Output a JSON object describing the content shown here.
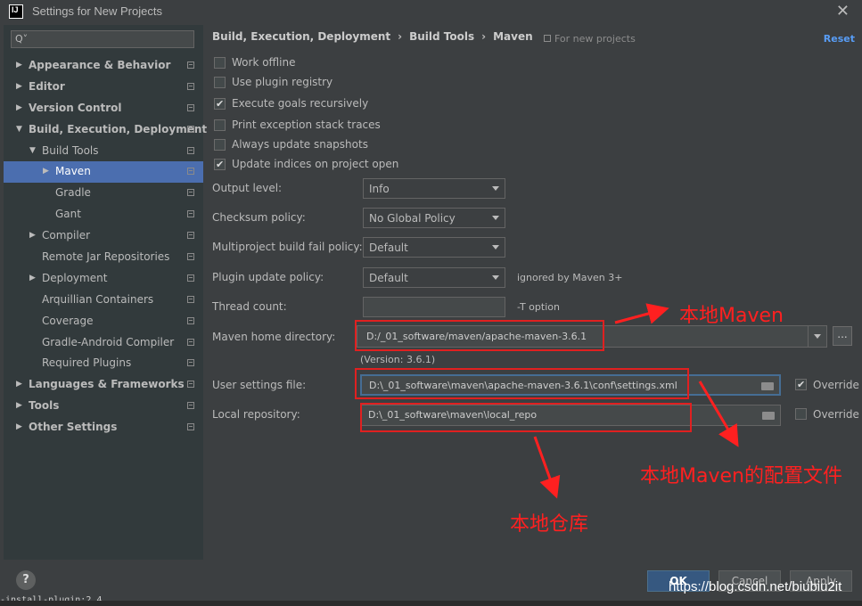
{
  "window": {
    "app_icon_text": "IJ",
    "title": "Settings for New Projects"
  },
  "sidebar": {
    "search_placeholder": "",
    "items": [
      {
        "label": "Appearance & Behavior",
        "level": 0,
        "arrow": "▶",
        "bold": true
      },
      {
        "label": "Editor",
        "level": 0,
        "arrow": "▶",
        "bold": true
      },
      {
        "label": "Version Control",
        "level": 0,
        "arrow": "▶",
        "bold": true
      },
      {
        "label": "Build, Execution, Deployment",
        "level": 0,
        "arrow": "▼",
        "bold": true
      },
      {
        "label": "Build Tools",
        "level": 1,
        "arrow": "▼",
        "bold": false
      },
      {
        "label": "Maven",
        "level": 2,
        "arrow": "▶",
        "bold": false,
        "selected": true
      },
      {
        "label": "Gradle",
        "level": 2,
        "arrow": "",
        "bold": false
      },
      {
        "label": "Gant",
        "level": 2,
        "arrow": "",
        "bold": false
      },
      {
        "label": "Compiler",
        "level": 1,
        "arrow": "▶",
        "bold": false
      },
      {
        "label": "Remote Jar Repositories",
        "level": 1,
        "arrow": "",
        "bold": false
      },
      {
        "label": "Deployment",
        "level": 1,
        "arrow": "▶",
        "bold": false
      },
      {
        "label": "Arquillian Containers",
        "level": 1,
        "arrow": "",
        "bold": false
      },
      {
        "label": "Coverage",
        "level": 1,
        "arrow": "",
        "bold": false
      },
      {
        "label": "Gradle-Android Compiler",
        "level": 1,
        "arrow": "",
        "bold": false
      },
      {
        "label": "Required Plugins",
        "level": 1,
        "arrow": "",
        "bold": false
      },
      {
        "label": "Languages & Frameworks",
        "level": 0,
        "arrow": "▶",
        "bold": true
      },
      {
        "label": "Tools",
        "level": 0,
        "arrow": "▶",
        "bold": true
      },
      {
        "label": "Other Settings",
        "level": 0,
        "arrow": "▶",
        "bold": true
      }
    ],
    "help_label": "?",
    "footer_text": "-install-plugin:2.4"
  },
  "breadcrumb": {
    "part1": "Build, Execution, Deployment",
    "part2": "Build Tools",
    "part3": "Maven",
    "separator": "›"
  },
  "header": {
    "for_new_projects": "For new projects",
    "reset_label": "Reset"
  },
  "options": {
    "work_offline": {
      "label": "Work offline",
      "checked": false
    },
    "use_plugin_registry": {
      "label": "Use plugin registry",
      "checked": false
    },
    "execute_goals_recursively": {
      "label": "Execute goals recursively",
      "checked": true
    },
    "print_exception_stack_traces": {
      "label": "Print exception stack traces",
      "checked": false
    },
    "always_update_snapshots": {
      "label": "Always update snapshots",
      "checked": false
    },
    "update_indices": {
      "label": "Update indices on project open",
      "checked": true
    }
  },
  "form": {
    "output_level": {
      "label": "Output level:",
      "value": "Info"
    },
    "checksum_policy": {
      "label": "Checksum policy:",
      "value": "No Global Policy"
    },
    "multiproject_fail_policy": {
      "label": "Multiproject build fail policy:",
      "value": "Default"
    },
    "plugin_update_policy": {
      "label": "Plugin update policy:",
      "value": "Default",
      "hint": "ignored by Maven 3+"
    },
    "thread_count": {
      "label": "Thread count:",
      "value": "",
      "hint": "-T option"
    },
    "maven_home": {
      "label": "Maven home directory:",
      "value": "D:/_01_software/maven/apache-maven-3.6.1",
      "version": "(Version: 3.6.1)",
      "browse_label": "..."
    },
    "user_settings": {
      "label": "User settings file:",
      "value": "D:\\_01_software\\maven\\apache-maven-3.6.1\\conf\\settings.xml",
      "override_label": "Override",
      "override_checked": true
    },
    "local_repo": {
      "label": "Local repository:",
      "value": "D:\\_01_software\\maven\\local_repo",
      "override_label": "Override",
      "override_checked": false
    }
  },
  "annotations": {
    "maven_home": "本地Maven",
    "settings_file": "本地Maven的配置文件",
    "local_repo": "本地仓库",
    "color": "#ff2020"
  },
  "buttons": {
    "ok": "OK",
    "cancel": "Cancel",
    "apply": "Apply"
  },
  "watermark": "https://blog.csdn.net/biubiu2it",
  "colors": {
    "accent_selected": "#4b6eaf",
    "link": "#589df6",
    "background": "#3c3f41"
  }
}
